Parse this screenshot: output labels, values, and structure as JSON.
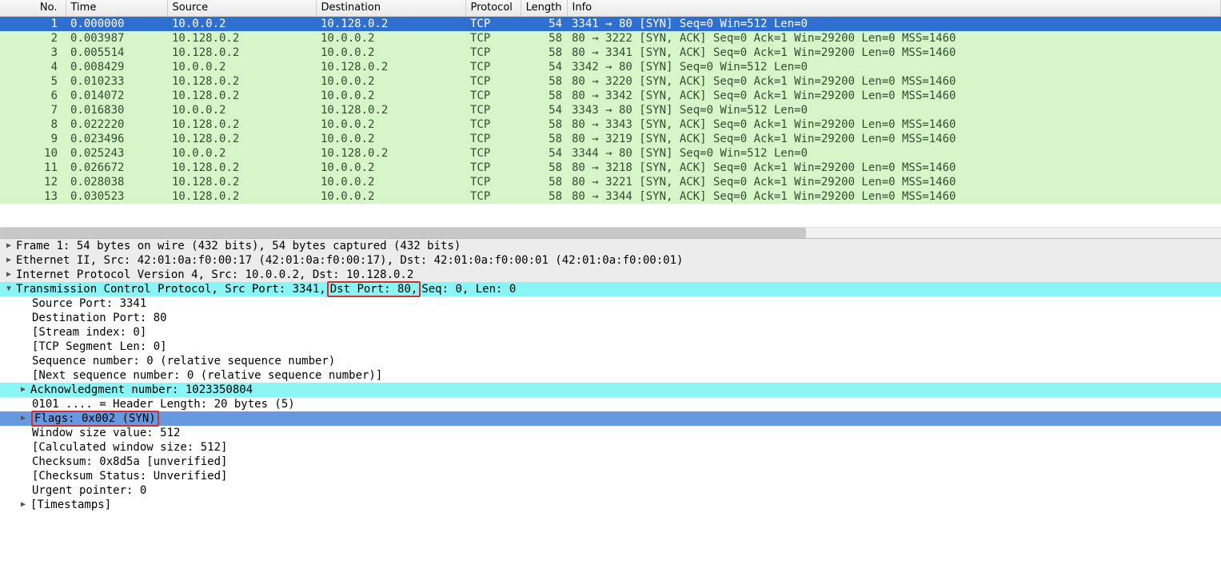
{
  "columns": {
    "no": "No.",
    "time": "Time",
    "source": "Source",
    "destination": "Destination",
    "protocol": "Protocol",
    "length": "Length",
    "info": "Info"
  },
  "packets": [
    {
      "no": "1",
      "time": "0.000000",
      "source": "10.0.0.2",
      "dest": "10.128.0.2",
      "proto": "TCP",
      "len": "54",
      "info": "3341 → 80 [SYN] Seq=0 Win=512 Len=0",
      "selected": true
    },
    {
      "no": "2",
      "time": "0.003987",
      "source": "10.128.0.2",
      "dest": "10.0.0.2",
      "proto": "TCP",
      "len": "58",
      "info": "80 → 3222 [SYN, ACK] Seq=0 Ack=1 Win=29200 Len=0 MSS=1460"
    },
    {
      "no": "3",
      "time": "0.005514",
      "source": "10.128.0.2",
      "dest": "10.0.0.2",
      "proto": "TCP",
      "len": "58",
      "info": "80 → 3341 [SYN, ACK] Seq=0 Ack=1 Win=29200 Len=0 MSS=1460"
    },
    {
      "no": "4",
      "time": "0.008429",
      "source": "10.0.0.2",
      "dest": "10.128.0.2",
      "proto": "TCP",
      "len": "54",
      "info": "3342 → 80 [SYN] Seq=0 Win=512 Len=0"
    },
    {
      "no": "5",
      "time": "0.010233",
      "source": "10.128.0.2",
      "dest": "10.0.0.2",
      "proto": "TCP",
      "len": "58",
      "info": "80 → 3220 [SYN, ACK] Seq=0 Ack=1 Win=29200 Len=0 MSS=1460"
    },
    {
      "no": "6",
      "time": "0.014072",
      "source": "10.128.0.2",
      "dest": "10.0.0.2",
      "proto": "TCP",
      "len": "58",
      "info": "80 → 3342 [SYN, ACK] Seq=0 Ack=1 Win=29200 Len=0 MSS=1460"
    },
    {
      "no": "7",
      "time": "0.016830",
      "source": "10.0.0.2",
      "dest": "10.128.0.2",
      "proto": "TCP",
      "len": "54",
      "info": "3343 → 80 [SYN] Seq=0 Win=512 Len=0"
    },
    {
      "no": "8",
      "time": "0.022220",
      "source": "10.128.0.2",
      "dest": "10.0.0.2",
      "proto": "TCP",
      "len": "58",
      "info": "80 → 3343 [SYN, ACK] Seq=0 Ack=1 Win=29200 Len=0 MSS=1460"
    },
    {
      "no": "9",
      "time": "0.023496",
      "source": "10.128.0.2",
      "dest": "10.0.0.2",
      "proto": "TCP",
      "len": "58",
      "info": "80 → 3219 [SYN, ACK] Seq=0 Ack=1 Win=29200 Len=0 MSS=1460"
    },
    {
      "no": "10",
      "time": "0.025243",
      "source": "10.0.0.2",
      "dest": "10.128.0.2",
      "proto": "TCP",
      "len": "54",
      "info": "3344 → 80 [SYN] Seq=0 Win=512 Len=0"
    },
    {
      "no": "11",
      "time": "0.026672",
      "source": "10.128.0.2",
      "dest": "10.0.0.2",
      "proto": "TCP",
      "len": "58",
      "info": "80 → 3218 [SYN, ACK] Seq=0 Ack=1 Win=29200 Len=0 MSS=1460"
    },
    {
      "no": "12",
      "time": "0.028038",
      "source": "10.128.0.2",
      "dest": "10.0.0.2",
      "proto": "TCP",
      "len": "58",
      "info": "80 → 3221 [SYN, ACK] Seq=0 Ack=1 Win=29200 Len=0 MSS=1460"
    },
    {
      "no": "13",
      "time": "0.030523",
      "source": "10.128.0.2",
      "dest": "10.0.0.2",
      "proto": "TCP",
      "len": "58",
      "info": "80 → 3344 [SYN, ACK] Seq=0 Ack=1 Win=29200 Len=0 MSS=1460"
    }
  ],
  "details": {
    "frame": "Frame 1: 54 bytes on wire (432 bits), 54 bytes captured (432 bits)",
    "ethernet": "Ethernet II, Src: 42:01:0a:f0:00:17 (42:01:0a:f0:00:17), Dst: 42:01:0a:f0:00:01 (42:01:0a:f0:00:01)",
    "ip": "Internet Protocol Version 4, Src: 10.0.0.2, Dst: 10.128.0.2",
    "tcp_pre": "Transmission Control Protocol, Src Port: 3341, ",
    "tcp_hl": "Dst Port: 80,",
    "tcp_post": " Seq: 0, Len: 0",
    "src_port": "Source Port: 3341",
    "dst_port": "Destination Port: 80",
    "stream": "[Stream index: 0]",
    "seg_len": "[TCP Segment Len: 0]",
    "seq": "Sequence number: 0    (relative sequence number)",
    "next_seq": "[Next sequence number: 0    (relative sequence number)]",
    "ack": "Acknowledgment number: 1023350804",
    "hdr_len": "0101 .... = Header Length: 20 bytes (5)",
    "flags": "Flags: 0x002 (SYN)",
    "win": "Window size value: 512",
    "calc_win": "[Calculated window size: 512]",
    "cksum": "Checksum: 0x8d5a [unverified]",
    "cksum_status": "[Checksum Status: Unverified]",
    "urgent": "Urgent pointer: 0",
    "timestamps": "[Timestamps]"
  }
}
